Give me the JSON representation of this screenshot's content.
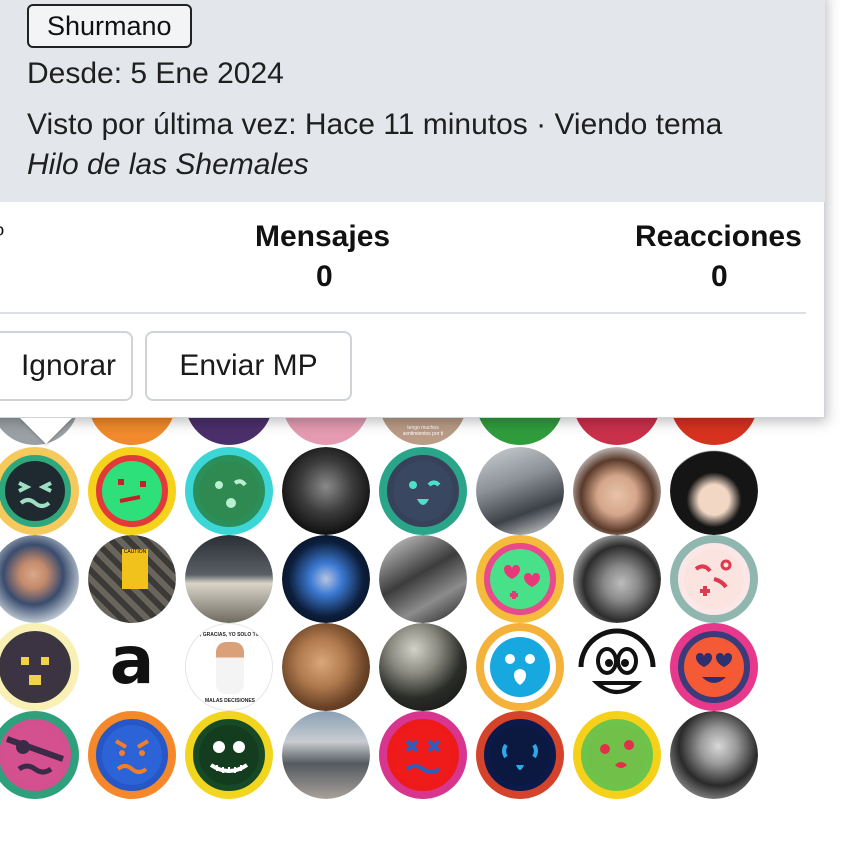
{
  "member_card": {
    "role_tag": "Shurmano",
    "joined": "Desde: 5 Ene 2024",
    "last_seen_text": "Visto por última vez: Hace 11 minutos · Viendo tema",
    "last_seen_thread": "Hilo de las Shemales",
    "stats": {
      "left_partial_label": "º",
      "messages_label": "Mensajes",
      "messages_value": "0",
      "reactions_label": "Reacciones",
      "reactions_value": "0"
    },
    "buttons": {
      "ignore_label": "Ignorar",
      "send_pm_label": "Enviar MP"
    }
  },
  "avatar_photos": {
    "caution_sign_text": "CAUTION",
    "mug_text": "tengo muchos sentimientos por ti",
    "sticker_top_text": "NO, GRACIAS, YO SOLO TOMO",
    "sticker_bottom_text": "MALAS DECISIONES"
  },
  "colors": {
    "card_header_bg": "#e3e7ec",
    "card_bg": "#ffffff",
    "button_border": "#cfd3d8"
  }
}
